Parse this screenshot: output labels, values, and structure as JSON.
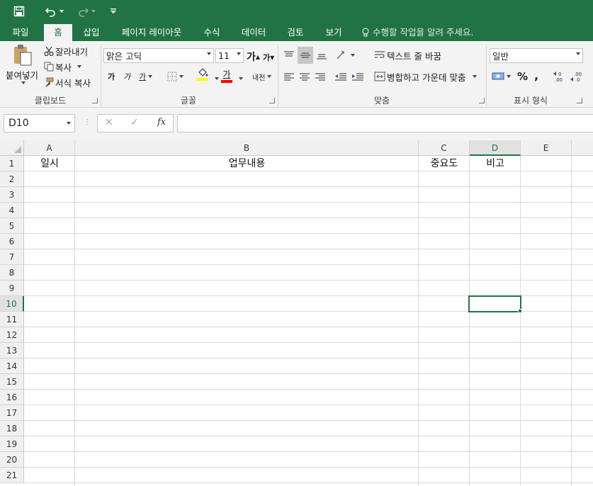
{
  "quick_access": {
    "save_icon": "save-icon",
    "undo_icon": "undo-icon",
    "redo_icon": "redo-icon",
    "customize_icon": "customize-quick-access-icon"
  },
  "tabs": [
    {
      "label": "파일"
    },
    {
      "label": "홈"
    },
    {
      "label": "삽입"
    },
    {
      "label": "페이지 레이아웃"
    },
    {
      "label": "수식"
    },
    {
      "label": "데이터"
    },
    {
      "label": "검토"
    },
    {
      "label": "보기"
    }
  ],
  "tell_me": "수행할 작업을 알려 주세요.",
  "clipboard": {
    "paste": "붙여넣기",
    "cut": "잘라내기",
    "copy": "복사",
    "format_painter": "서식 복사",
    "group_label": "클립보드"
  },
  "font": {
    "name": "맑은 고딕",
    "size": "11",
    "grow": "가",
    "shrink": "가",
    "bold": "가",
    "italic": "가",
    "underline": "가",
    "font_color_glyph": "가",
    "phonetic": "내천",
    "group_label": "글꼴"
  },
  "alignment": {
    "wrap_text": "텍스트 줄 바꿈",
    "merge_center": "병합하고 가운데 맞춤",
    "group_label": "맞춤"
  },
  "number": {
    "format": "일반",
    "percent": "%",
    "comma": ",",
    "group_label": "표시 형식"
  },
  "formula_bar": {
    "name_box": "D10",
    "cancel": "✕",
    "enter": "✓",
    "fx": "fx",
    "formula": ""
  },
  "sheet": {
    "columns": [
      "A",
      "B",
      "C",
      "D",
      "E"
    ],
    "rows": [
      "1",
      "2",
      "3",
      "4",
      "5",
      "6",
      "7",
      "8",
      "9",
      "10",
      "11",
      "12",
      "13",
      "14",
      "15",
      "16",
      "17",
      "18",
      "19",
      "20",
      "21"
    ],
    "selected_cell": "D10",
    "cells": {
      "A1": "일시",
      "B1": "업무내용",
      "C1": "중요도",
      "D1": "비고"
    }
  },
  "colors": {
    "accent": "#217346",
    "ribbon_bg": "#f3f3f3",
    "highlight_yellow": "#ffff00",
    "font_red": "#ff0000"
  }
}
